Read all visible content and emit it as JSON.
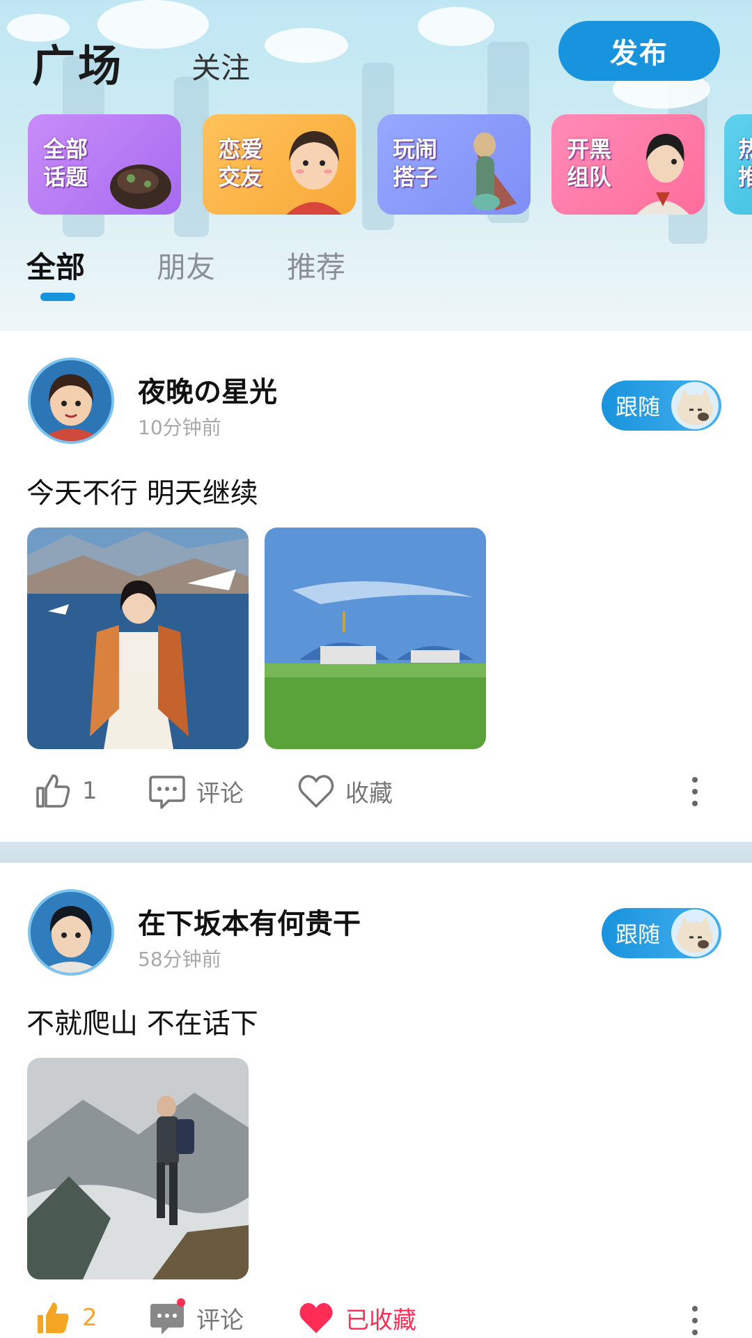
{
  "header": {
    "title": "广场",
    "subtitle": "关注",
    "publish_label": "发布"
  },
  "topics": [
    {
      "label": "全部\n话题",
      "color": "#c07ef5"
    },
    {
      "label": "恋爱\n交友",
      "color": "#fcb548"
    },
    {
      "label": "玩闹\n搭子",
      "color": "#8aa0ff"
    },
    {
      "label": "开黑\n组队",
      "color": "#ff79a8"
    },
    {
      "label": "热\n推",
      "color": "#4cc7e8"
    }
  ],
  "tabs": [
    "全部",
    "朋友",
    "推荐"
  ],
  "posts": [
    {
      "username": "夜晚の星光",
      "time": "10分钟前",
      "follow_label": "跟随",
      "text": "今天不行 明天继续",
      "likes": "1",
      "comment_label": "评论",
      "collect_label": "收藏"
    },
    {
      "username": "在下坂本有何贵干",
      "time": "58分钟前",
      "follow_label": "跟随",
      "text": "不就爬山 不在话下",
      "likes": "2",
      "comment_label": "评论",
      "collect_label": "已收藏"
    }
  ],
  "colors": {
    "accent": "#1893dd",
    "liked": "#f5a623",
    "collected": "#ff2d55"
  }
}
